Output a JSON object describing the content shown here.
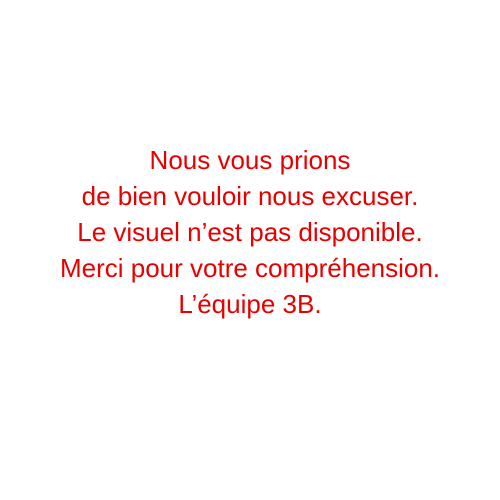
{
  "message": {
    "lines": [
      "Nous vous prions",
      "de bien vouloir nous excuser.",
      "Le visuel n’est pas disponible.",
      "Merci pour votre compréhension.",
      "L’équipe 3B."
    ]
  },
  "colors": {
    "background": "#ffffff",
    "text": "#e80000"
  }
}
